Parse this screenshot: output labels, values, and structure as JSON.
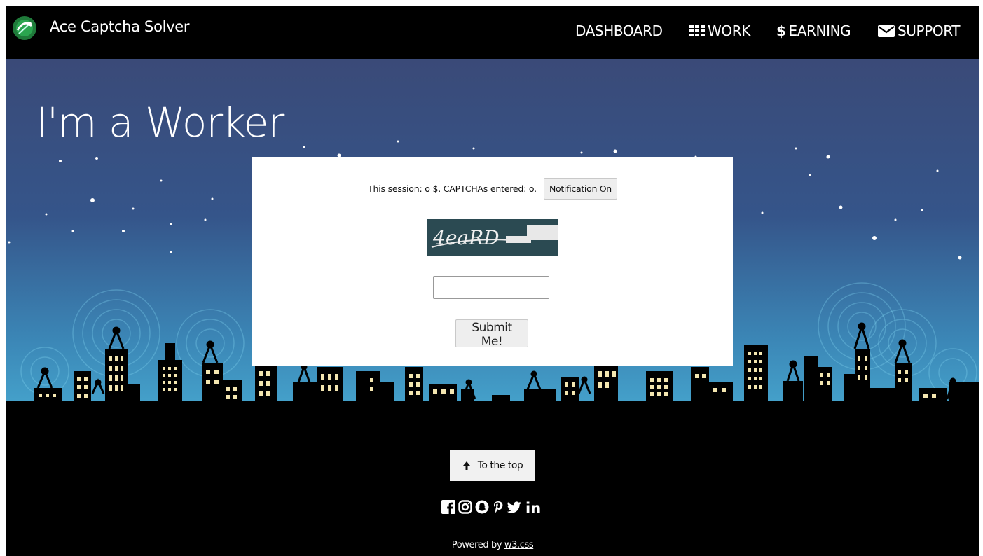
{
  "brand": {
    "name": "Ace Captcha Solver"
  },
  "nav": {
    "dashboard": "DASHBOARD",
    "work": "WORK",
    "earning": "EARNING",
    "support": "SUPPORT",
    "earning_symbol": "$"
  },
  "hero": {
    "title": "I'm a Worker"
  },
  "session": {
    "text": "This session: o $. CAPTCHAs entered: o.",
    "notification_button": "Notification On"
  },
  "captcha": {
    "text": "4eaRD"
  },
  "answer": {
    "value": ""
  },
  "submit": {
    "label": "Submit Me!"
  },
  "footer": {
    "to_top": "To the top",
    "social_icons": [
      "facebook-icon",
      "instagram-icon",
      "snapchat-icon",
      "pinterest-icon",
      "twitter-icon",
      "linkedin-icon"
    ],
    "linkedin_text": "in",
    "powered_prefix": "Powered by",
    "powered_link": "w3.css"
  },
  "colors": {
    "top_bar": "#000000",
    "sky_top": "#3a4a78",
    "sky_bottom": "#3f97c3",
    "card": "#ffffff",
    "captcha_bg": "#2b4a52"
  }
}
